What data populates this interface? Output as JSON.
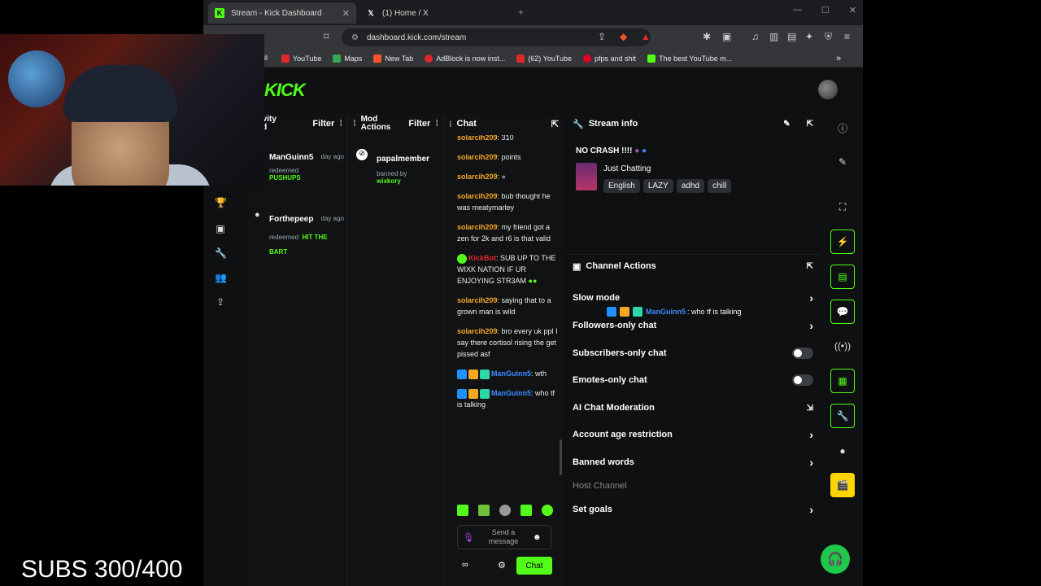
{
  "browser": {
    "tabs": [
      {
        "title": "Stream - Kick Dashboard",
        "active": true
      },
      {
        "title": "(1) Home / X",
        "active": false
      }
    ],
    "url": "dashboard.kick.com/stream",
    "bookmarks": [
      "YouTube",
      "Maps",
      "New Tab",
      "AdBlock is now inst...",
      "(62) YouTube",
      "pfps and shit",
      "The best YouTube m..."
    ],
    "bookmark_partial": "ail"
  },
  "logo": "KICK",
  "activity": {
    "header": "Activity Feed",
    "header_visible": "ctivity\need",
    "filter": "Filter",
    "items": [
      {
        "user": "ManGuinn5",
        "time": "day ago",
        "action": "redeemed",
        "reward": "PUSHUPS"
      },
      {
        "user": "Forthepeep",
        "time": "day ago",
        "action": "redeemed",
        "reward": "HIT THE BART"
      }
    ]
  },
  "modactions": {
    "header_1": "Mod",
    "header_2": "Actions",
    "filter": "Filter",
    "items": [
      {
        "user": "papalmember",
        "action": "banned by",
        "by": "wixkory"
      }
    ]
  },
  "chat": {
    "header": "Chat",
    "messages": [
      {
        "user": "solarcih209",
        "text": ": 310",
        "color": "orange"
      },
      {
        "user": "solarcih209",
        "text": ": points",
        "color": "orange"
      },
      {
        "user": "solarcih209",
        "text": ":",
        "color": "orange"
      },
      {
        "user": "solarcih209",
        "text": ": bub thought he was meatymarley",
        "color": "orange"
      },
      {
        "user": "solarcih209",
        "text": ": my friend got a zen for 2k and r6 is that valid",
        "color": "orange"
      },
      {
        "user": "KickBot",
        "text": ": SUB UP TO THE WIXK NATION IF UR ENJOYING STR3AM",
        "color": "red"
      },
      {
        "user": "solarcih209",
        "text": ": saying that to a grown man is wild",
        "color": "orange"
      },
      {
        "user": "solarcih209",
        "text": ": bro every uk ppl I say there cortisol rising the get pissed asf",
        "color": "orange"
      },
      {
        "user": "ManGuinn5",
        "text": ": wth",
        "color": "blue"
      },
      {
        "user": "ManGuinn5",
        "text": ": who tf is talking",
        "color": "blue"
      }
    ],
    "input_placeholder": "Send a message",
    "send_label": "Chat"
  },
  "stream_info": {
    "header": "Stream info",
    "title": "NO CRASH !!!!",
    "category": "Just Chatting",
    "tags": [
      "English",
      "LAZY",
      "adhd",
      "chill"
    ]
  },
  "channel_actions": {
    "header": "Channel Actions",
    "overlay_user": "ManGuinn5",
    "overlay_text": ": who tf is talking",
    "rows": [
      {
        "label": "Slow mode",
        "control": "arrow"
      },
      {
        "label": "Followers-only chat",
        "control": "arrow"
      },
      {
        "label": "Subscribers-only chat",
        "control": "toggle"
      },
      {
        "label": "Emotes-only chat",
        "control": "toggle"
      },
      {
        "label": "AI Chat Moderation",
        "control": "external"
      },
      {
        "label": "Account age restriction",
        "control": "arrow"
      },
      {
        "label": "Banned words",
        "control": "arrow"
      },
      {
        "label": "Host Channel",
        "control": "none"
      },
      {
        "label": "Set goals",
        "control": "arrow"
      }
    ]
  },
  "overlay": {
    "subs_text": "SUBS 300/400"
  },
  "colors": {
    "accent": "#53fc18",
    "bg": "#0e1011",
    "chat_user": "#f5a623",
    "chat_blue": "#3d8bff"
  }
}
